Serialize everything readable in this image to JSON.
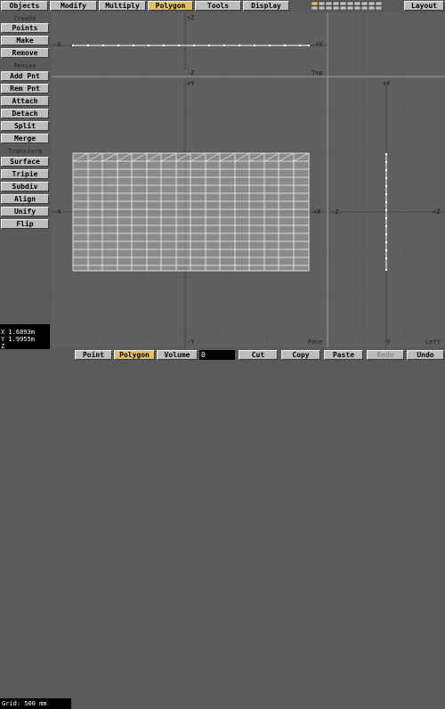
{
  "tabs": {
    "objects": "Objects",
    "modify": "Modify",
    "multiply": "Multiply",
    "polygon": "Polygon",
    "tools": "Tools",
    "display": "Display",
    "layout": "Layout"
  },
  "sidebar": {
    "create_header": "Create",
    "create_items": [
      "Points",
      "Make",
      "Remove"
    ],
    "revise_header": "Revise",
    "revise_items": [
      "Add Pnt",
      "Rem Pnt",
      "Attach",
      "Detach",
      "Split",
      "Merge"
    ],
    "transform_header": "Transform",
    "transform_items": [
      "Surface",
      "Tripie",
      "Subdiv",
      "Align",
      "Unify",
      "Flip"
    ]
  },
  "viewports": {
    "top_label": "Top",
    "face_label": "Face",
    "left_label": "Left",
    "axes": {
      "plus_z": "+Z",
      "minus_z": "-Z",
      "plus_x": "+X",
      "minus_x": "-X",
      "plus_y": "+Y",
      "minus_y": "-Y"
    }
  },
  "coords": {
    "x": "X 1.6893m",
    "y": "Y 1.9955m",
    "z": "Z"
  },
  "status": {
    "grid": "Grid: 500 mm",
    "point": "Point",
    "polygon": "Polygon",
    "volume": "Volume",
    "value": "0",
    "cut": "Cut",
    "copy": "Copy",
    "paste": "Paste",
    "redo": "Redo",
    "undo": "Undo"
  },
  "colors": {
    "active_tab": "#e0c060",
    "button": "#bdbdbd",
    "viewport_bg": "#5f5f5f",
    "mesh": "#ffffff"
  }
}
